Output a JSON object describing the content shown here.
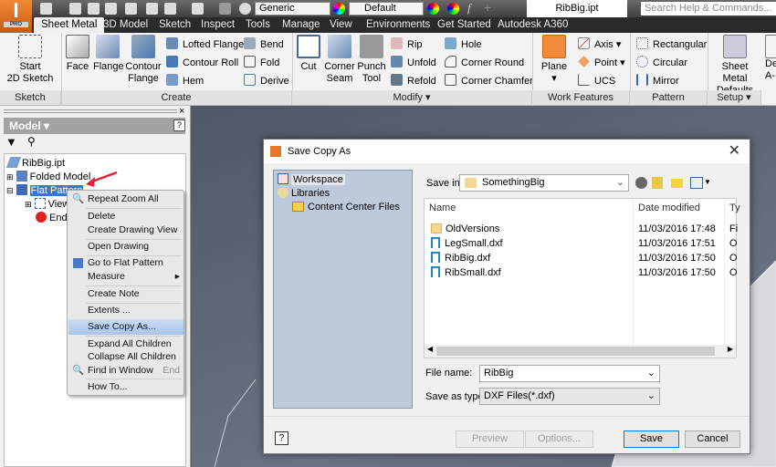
{
  "app": {
    "logo_text": "I",
    "logo_edition": "PRO",
    "document_title": "RibBig.ipt",
    "search_placeholder": "Search Help & Commands...",
    "material_combo": "Generic",
    "appearance_combo": "Default"
  },
  "tabs": [
    "Sheet Metal",
    "3D Model",
    "Sketch",
    "Inspect",
    "Tools",
    "Manage",
    "View",
    "Environments",
    "Get Started",
    "Autodesk A360"
  ],
  "ribbon": {
    "panels": [
      "Sketch",
      "Create",
      "Modify ▾",
      "Work Features",
      "Pattern",
      "Setup ▾"
    ],
    "sketch": {
      "start": "Start",
      "start2": "2D Sketch"
    },
    "create": {
      "face": "Face",
      "flange": "Flange",
      "contour": "Contour",
      "contour2": "Flange",
      "lofted": "Lofted Flange",
      "contour_roll": "Contour Roll",
      "hem": "Hem",
      "bend": "Bend",
      "fold": "Fold",
      "derive": "Derive"
    },
    "modify": {
      "cut": "Cut",
      "corner": "Corner",
      "corner2": "Seam",
      "punch": "Punch",
      "punch2": "Tool",
      "rip": "Rip",
      "unfold": "Unfold",
      "refold": "Refold",
      "hole": "Hole",
      "corner_round": "Corner Round",
      "corner_chamfer": "Corner Chamfer"
    },
    "work": {
      "plane": "Plane",
      "axis": "Axis",
      "point": "Point",
      "ucs": "UCS"
    },
    "pattern": {
      "rect": "Rectangular",
      "circ": "Circular",
      "mirror": "Mirror"
    },
    "setup": {
      "defaults": "Sheet Metal",
      "defaults2": "Defaults",
      "partial": "De",
      "partial2": "A-"
    }
  },
  "browser": {
    "title": "Model ▾",
    "root": "RibBig.ipt",
    "folded": "Folded Model",
    "flat": "Flat Pattern",
    "view": "View",
    "end": "End of"
  },
  "context_menu": [
    {
      "label": "Repeat Zoom All"
    },
    {
      "label": "Delete"
    },
    {
      "label": "Create Drawing View"
    },
    {
      "label": "Open Drawing"
    },
    {
      "label": "Go to Flat Pattern"
    },
    {
      "label": "Measure"
    },
    {
      "label": "Create Note"
    },
    {
      "label": "Extents ..."
    },
    {
      "label": "Save Copy As..."
    },
    {
      "label": "Expand All Children"
    },
    {
      "label": "Collapse All Children"
    },
    {
      "label": "Find in Window",
      "shortcut": "End"
    },
    {
      "label": "How To..."
    }
  ],
  "dialog": {
    "title": "Save Copy As",
    "places": [
      "Workspace",
      "Libraries",
      "Content Center Files"
    ],
    "save_in_label": "Save in:",
    "save_in_value": "SomethingBig",
    "columns": [
      "Name",
      "Date modified",
      "Ty"
    ],
    "files": [
      {
        "name": "OldVersions",
        "date": "11/03/2016 17:48",
        "type": "Fi",
        "kind": "folder"
      },
      {
        "name": "LegSmall.dxf",
        "date": "11/03/2016 17:51",
        "type": "O",
        "kind": "dxf"
      },
      {
        "name": "RibBig.dxf",
        "date": "11/03/2016 17:50",
        "type": "O",
        "kind": "dxf"
      },
      {
        "name": "RibSmall.dxf",
        "date": "11/03/2016 17:50",
        "type": "O",
        "kind": "dxf"
      }
    ],
    "file_name_label": "File name:",
    "file_name_value": "RibBig",
    "save_type_label": "Save as type:",
    "save_type_value": "DXF Files(*.dxf)",
    "preview": "Preview",
    "options": "Options...",
    "save": "Save",
    "cancel": "Cancel"
  },
  "colors": {
    "accent_orange": "#e8782a",
    "selection": "#3875d7",
    "menu_highlight": "#b6cfee"
  }
}
